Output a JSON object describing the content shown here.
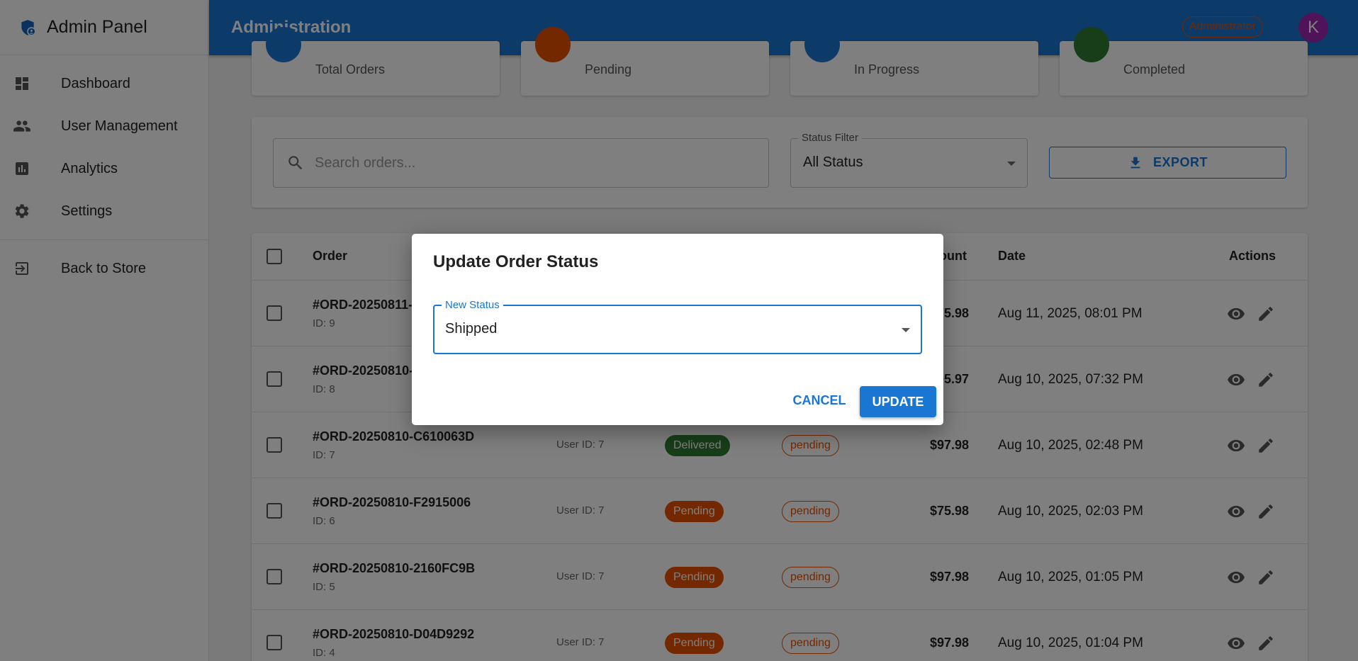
{
  "sidebar": {
    "brand": "Admin Panel",
    "items": [
      {
        "label": "Dashboard",
        "icon": "dashboard-icon"
      },
      {
        "label": "User Management",
        "icon": "people-icon"
      },
      {
        "label": "Analytics",
        "icon": "analytics-icon"
      },
      {
        "label": "Settings",
        "icon": "gear-icon"
      }
    ],
    "back_label": "Back to Store"
  },
  "appbar": {
    "title": "Administration",
    "role": "Administrator",
    "avatar_letter": "K"
  },
  "stats": [
    {
      "label": "Total Orders",
      "color": "#1976d2"
    },
    {
      "label": "Pending",
      "color": "#e65100"
    },
    {
      "label": "In Progress",
      "color": "#1976d2"
    },
    {
      "label": "Completed",
      "color": "#2e7d32"
    }
  ],
  "filters": {
    "search_placeholder": "Search orders...",
    "status_legend": "Status Filter",
    "status_value": "All Status",
    "export_label": "EXPORT"
  },
  "table": {
    "headers": {
      "order": "Order",
      "amount": "ount",
      "date": "Date",
      "actions": "Actions"
    },
    "rows": [
      {
        "order": "#ORD-20250811-",
        "id": "ID: 9",
        "user": "",
        "status": "",
        "payment": "",
        "amount": "75.98",
        "date": "Aug 11, 2025, 08:01 PM"
      },
      {
        "order": "#ORD-20250810-",
        "id": "ID: 8",
        "user": "",
        "status": "",
        "payment": "",
        "amount": "95.97",
        "date": "Aug 10, 2025, 07:32 PM"
      },
      {
        "order": "#ORD-20250810-C610063D",
        "id": "ID: 7",
        "user": "User ID: 7",
        "status": "Delivered",
        "payment": "pending",
        "amount": "$97.98",
        "date": "Aug 10, 2025, 02:48 PM"
      },
      {
        "order": "#ORD-20250810-F2915006",
        "id": "ID: 6",
        "user": "User ID: 7",
        "status": "Pending",
        "payment": "pending",
        "amount": "$75.98",
        "date": "Aug 10, 2025, 02:03 PM"
      },
      {
        "order": "#ORD-20250810-2160FC9B",
        "id": "ID: 5",
        "user": "User ID: 7",
        "status": "Pending",
        "payment": "pending",
        "amount": "$97.98",
        "date": "Aug 10, 2025, 01:05 PM"
      },
      {
        "order": "#ORD-20250810-D04D9292",
        "id": "ID: 4",
        "user": "User ID: 7",
        "status": "Pending",
        "payment": "pending",
        "amount": "$97.98",
        "date": "Aug 10, 2025, 01:04 PM"
      }
    ]
  },
  "dialog": {
    "title": "Update Order Status",
    "field_legend": "New Status",
    "field_value": "Shipped",
    "cancel_label": "CANCEL",
    "update_label": "UPDATE"
  },
  "colors": {
    "primary": "#1976d2",
    "delivered": "#2e7d32",
    "pending": "#e65100",
    "avatar": "#9c27b0"
  }
}
